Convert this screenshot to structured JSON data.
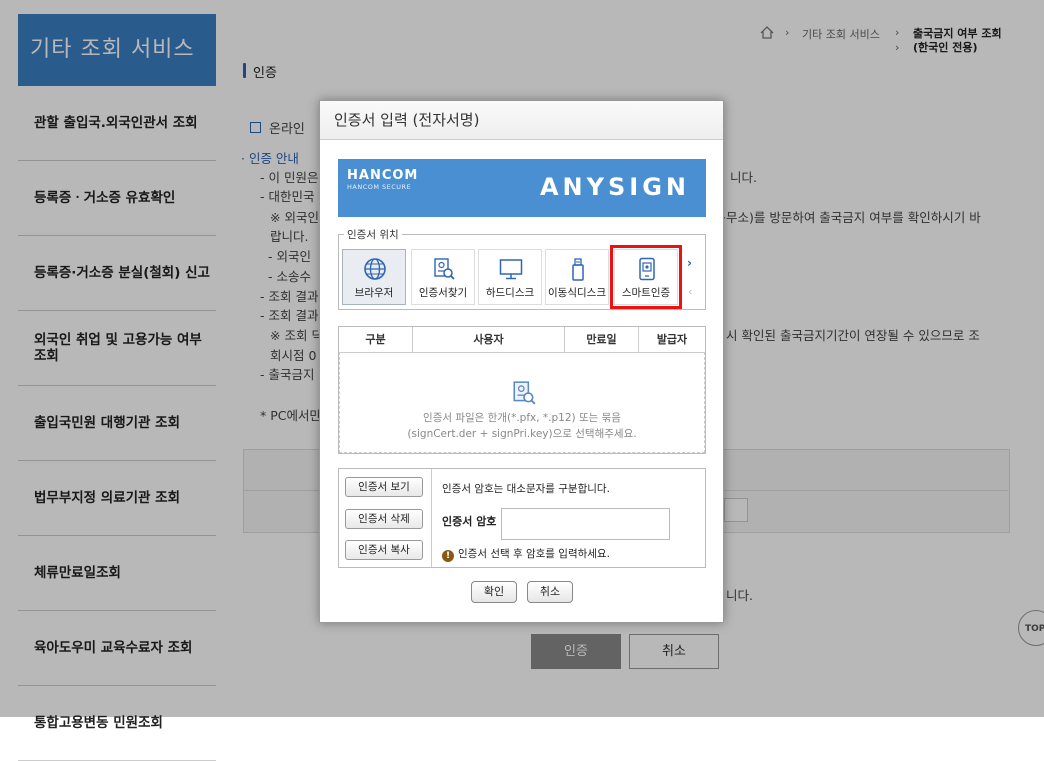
{
  "sidebar": {
    "title": "기타 조회 서비스",
    "items": [
      {
        "label": "관할 출입국.외국인관서 조회"
      },
      {
        "label": "등록증ㆍ거소증 유효확인"
      },
      {
        "label": "등록증·거소증 분실(철회) 신고"
      },
      {
        "label": "외국인 취업 및 고용가능 여부 조회"
      },
      {
        "label": "출입국민원 대행기관 조회"
      },
      {
        "label": "법무부지정 의료기관 조회"
      },
      {
        "label": "체류만료일조회"
      },
      {
        "label": "육아도우미 교육수료자 조회"
      },
      {
        "label": "통합고용변동 민원조회"
      }
    ]
  },
  "breadcrumb": {
    "parent": "기타 조회 서비스",
    "current_line1": "출국금지 여부 조회",
    "current_line2": "(한국인 전용)"
  },
  "page": {
    "section_title": "인증",
    "online_label": "온라인",
    "auth_guide": "· 인증 안내",
    "lines": [
      "- 이 민원은",
      "- 대한민국",
      "※ 외국인",
      "랍니다.",
      "- 외국인",
      "- 소송수",
      "- 조회 결과",
      "- 조회 결과",
      "※ 조회 딕",
      "회시점 0",
      "- 출국금지",
      "* PC에서만"
    ],
    "right_lines": [
      "니다.",
      "·무소)를 방문하여 출국금지 여부를 확인하시기 바",
      "시 확인된 출국금지기간이 연장될 수 있으므로 조",
      "니다."
    ],
    "auth_button": "인증",
    "cancel_button": "취소",
    "top_button": "TOP"
  },
  "dialog": {
    "title": "인증서 입력 (전자서명)",
    "banner_brand": "HANCOM",
    "banner_brand_sub": "HANCOM SECURE",
    "banner_product": "ANYSIGN",
    "location_label": "인증서 위치",
    "locations": [
      {
        "label": "브라우저",
        "icon": "globe-icon"
      },
      {
        "label": "인증서찾기",
        "icon": "cert-search-icon"
      },
      {
        "label": "하드디스크",
        "icon": "monitor-icon"
      },
      {
        "label": "이동식디스크",
        "icon": "usb-icon"
      },
      {
        "label": "스마트인증",
        "icon": "smartphone-icon"
      }
    ],
    "selected_location": "브라우저",
    "highlighted_location": "스마트인증",
    "table_headers": [
      "구분",
      "사용자",
      "만료일",
      "발급자"
    ],
    "empty_line1": "인증서 파일은 한개(*.pfx, *.p12) 또는 묶음",
    "empty_line2": "(signCert.der + signPri.key)으로 선택해주세요.",
    "view_button": "인증서 보기",
    "delete_button": "인증서 삭제",
    "copy_button": "인증서 복사",
    "case_note": "인증서 암호는 대소문자를 구분합니다.",
    "password_label": "인증서 암호",
    "password_value": "",
    "warning": "인증서 선택 후 암호를 입력하세요.",
    "confirm_button": "확인",
    "cancel_button": "취소"
  },
  "colors": {
    "sidebar_header": "#3b7fc4",
    "banner": "#4a8fd2",
    "highlight": "#ee1111"
  }
}
